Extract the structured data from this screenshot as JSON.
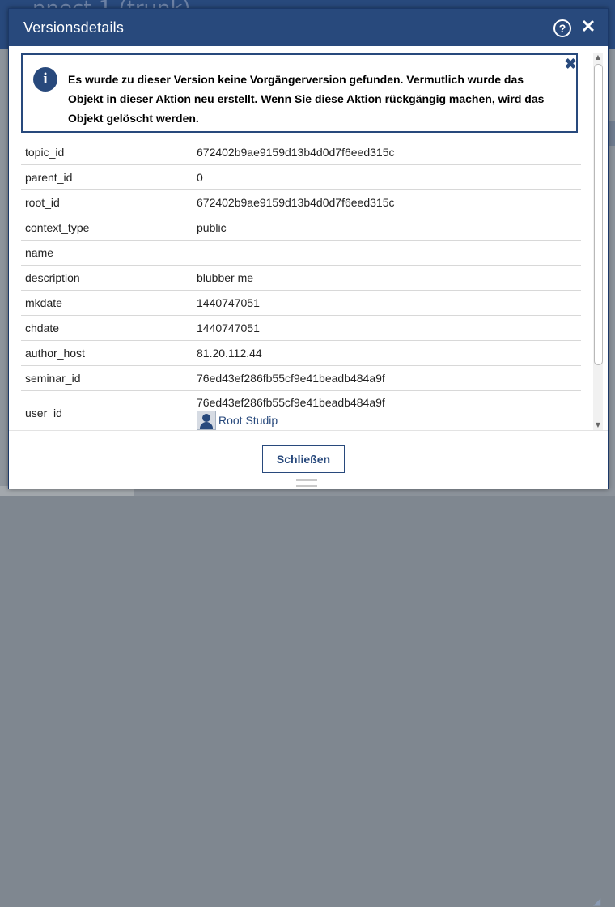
{
  "background": {
    "app_title_fragment": "nnect 1 (trunk)"
  },
  "dialog": {
    "title": "Versionsdetails",
    "help_glyph": "?",
    "close_glyph": "✕"
  },
  "info": {
    "icon": "info-icon",
    "message": "Es wurde zu dieser Version keine Vorgängerversion gefunden. Vermutlich wurde das Objekt in dieser Aktion neu erstellt. Wenn Sie diese Aktion rückgängig machen, wird das Objekt gelöscht werden.",
    "close_glyph": "✖"
  },
  "fields": [
    {
      "key": "topic_id",
      "value": "672402b9ae9159d13b4d0d7f6eed315c"
    },
    {
      "key": "parent_id",
      "value": "0"
    },
    {
      "key": "root_id",
      "value": "672402b9ae9159d13b4d0d7f6eed315c"
    },
    {
      "key": "context_type",
      "value": "public"
    },
    {
      "key": "name",
      "value": ""
    },
    {
      "key": "description",
      "value": "blubber me"
    },
    {
      "key": "mkdate",
      "value": "1440747051"
    },
    {
      "key": "chdate",
      "value": "1440747051"
    },
    {
      "key": "author_host",
      "value": "81.20.112.44"
    },
    {
      "key": "seminar_id",
      "value": "76ed43ef286fb55cf9e41beadb484a9f"
    }
  ],
  "user_field": {
    "key": "user_id",
    "value": "76ed43ef286fb55cf9e41beadb484a9f",
    "user_name": "Root Studip"
  },
  "footer": {
    "close_label": "Schließen"
  },
  "colors": {
    "accent": "#28497c"
  }
}
